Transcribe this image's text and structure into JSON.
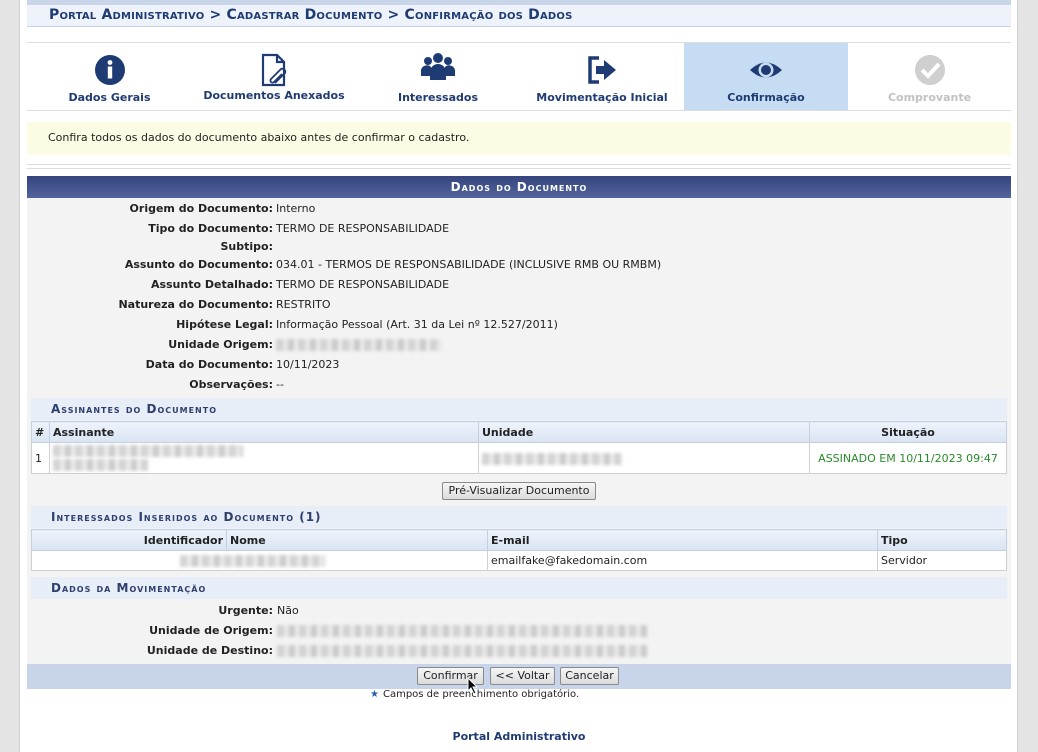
{
  "breadcrumb": "Portal Administrativo > Cadastrar Documento > Confirmação dos Dados",
  "steps": [
    {
      "label": "Dados Gerais",
      "icon": "info-icon"
    },
    {
      "label": "Documentos Anexados",
      "icon": "document-attach-icon"
    },
    {
      "label": "Interessados",
      "icon": "users-group-icon"
    },
    {
      "label": "Movimentação Inicial",
      "icon": "sign-out-icon"
    },
    {
      "label": "Confirmação",
      "icon": "eye-icon",
      "active": true
    },
    {
      "label": "Comprovante",
      "icon": "check-circle-icon",
      "disabled": true
    }
  ],
  "notice": "Confira todos os dados do documento abaixo antes de confirmar o cadastro.",
  "dados": {
    "caption": "Dados do Documento",
    "fields": [
      {
        "label": "Origem do Documento:",
        "value": "Interno"
      },
      {
        "label": "Tipo do Documento:",
        "value": "TERMO DE RESPONSABILIDADE"
      },
      {
        "label": "Subtipo:",
        "value": ""
      },
      {
        "label": "Assunto do Documento:",
        "value": "034.01 - TERMOS DE RESPONSABILIDADE (INCLUSIVE RMB OU RMBM)"
      },
      {
        "label": "Assunto Detalhado:",
        "value": "TERMO DE RESPONSABILIDADE"
      },
      {
        "label": "Natureza do Documento:",
        "value": "RESTRITO"
      },
      {
        "label": "Hipótese Legal:",
        "value": "Informação Pessoal (Art. 31 da Lei nº 12.527/2011)"
      },
      {
        "label": "Unidade Origem:",
        "value": ""
      },
      {
        "label": "Data do Documento:",
        "value": "10/11/2023"
      },
      {
        "label": "Observações:",
        "value": "--"
      }
    ]
  },
  "assinantes": {
    "caption": "Assinantes do Documento",
    "headers": [
      "#",
      "Assinante",
      "Unidade",
      "Situação"
    ],
    "rows": [
      {
        "num": "1",
        "situacao": "ASSINADO EM 10/11/2023 09:47"
      }
    ],
    "preview_button": "Pré-Visualizar Documento"
  },
  "interessados": {
    "caption": "Interessados Inseridos ao Documento (1)",
    "headers": [
      "Identificador",
      "Nome",
      "E-mail",
      "Tipo"
    ],
    "rows": [
      {
        "email": "emailfake@fakedomain.com",
        "tipo": "Servidor"
      }
    ]
  },
  "movimentacao": {
    "caption": "Dados da Movimentação",
    "fields": [
      {
        "label": "Urgente:",
        "value": "Não"
      },
      {
        "label": "Unidade de Origem:",
        "value": ""
      },
      {
        "label": "Unidade de Destino:",
        "value": ""
      }
    ]
  },
  "buttons": {
    "confirm": "Confirmar",
    "back": "<< Voltar",
    "cancel": "Cancelar"
  },
  "required_note": "Campos de preenchimento obrigatório.",
  "footer_link": "Portal Administrativo",
  "colors": {
    "header": "#35447c",
    "active_step": "#c5dcf3",
    "signed": "#2a8a2a"
  }
}
